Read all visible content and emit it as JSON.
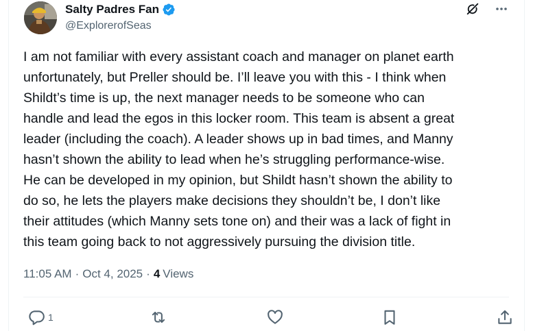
{
  "author": {
    "display_name": "Salty Padres Fan",
    "handle": "@ExplorerofSeas",
    "avatar_icon": "avatar-photo",
    "verified_icon": "verified-badge-icon",
    "verified_color": "#1d9bf0"
  },
  "header_icons": [
    "grok-icon",
    "more-options-icon"
  ],
  "tweet": {
    "text": "I am not familiar with every assistant coach and manager on planet earth\nunfortunately, but Preller should be. I’ll leave you with this - I think when\nShildt’s time is up, the next manager needs to be someone who can\nhandle and lead the egos in this locker room. This team is absent a great\nleader (including the coach). A leader shows up in bad times, and Manny\nhasn’t shown the ability to lead when he’s struggling performance-wise.\nHe can be developed in my opinion, but Shildt hasn’t shown the ability to\ndo so, he lets the players make decisions they shouldn’t be, I don’t like\ntheir attitudes (which Manny sets tone on) and their was a lack of fight in\nthis team going back to not aggressively pursuing the division title."
  },
  "meta": {
    "time": "11:05 AM",
    "date": "Oct 4, 2025",
    "views_count": "4",
    "views_label": "Views",
    "separator": "·"
  },
  "actions": {
    "reply": {
      "icon": "reply-icon",
      "count": "1"
    },
    "repost": {
      "icon": "repost-icon"
    },
    "like": {
      "icon": "like-icon"
    },
    "bookmark": {
      "icon": "bookmark-icon"
    },
    "share": {
      "icon": "share-icon"
    }
  },
  "colors": {
    "text_primary": "#0f1419",
    "text_secondary": "#536471",
    "border": "#eff3f4",
    "accent": "#1d9bf0"
  }
}
